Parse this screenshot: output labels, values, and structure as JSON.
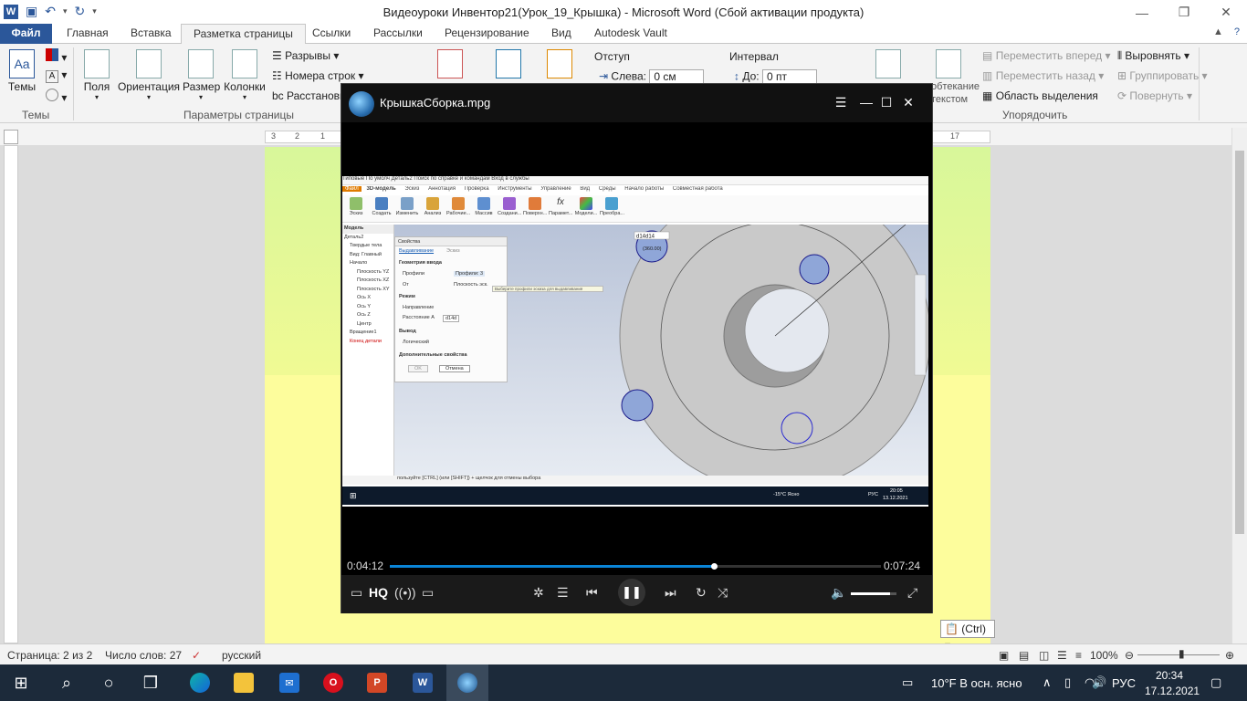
{
  "word": {
    "title": "Видеоуроки Инвентор21(Урок_19_Крышка)  -  Microsoft Word (Сбой активации продукта)",
    "tabs": {
      "file": "Файл",
      "home": "Главная",
      "insert": "Вставка",
      "page_layout": "Разметка страницы",
      "references": "Ссылки",
      "mailings": "Рассылки",
      "review": "Рецензирование",
      "view": "Вид",
      "vault": "Autodesk Vault"
    },
    "ribbon": {
      "themes": "Темы",
      "themes_group": "Темы",
      "margins": "Поля",
      "orientation": "Ориентация",
      "size": "Размер",
      "columns": "Колонки",
      "breaks": "Разрывы",
      "line_numbers": "Номера строк",
      "hyphenation": "Расстановк",
      "page_setup_group": "Параметры страницы",
      "indent_label": "Отступ",
      "indent_left_label": "Слева:",
      "indent_left_value": "0 см",
      "spacing_label": "Интервал",
      "spacing_before_label": "До:",
      "spacing_before_value": "0 пт",
      "bring_forward": "Переместить вперед",
      "send_backward": "Переместить назад",
      "selection_pane": "Область выделения",
      "align": "Выровнять",
      "group": "Группировать",
      "rotate": "Повернуть",
      "arrange_group": "Упорядочить",
      "wrap_text_1": "обтекание",
      "wrap_text_2": "текстом"
    },
    "ruler_numbers": [
      "3",
      "2",
      "1",
      "17"
    ],
    "paste_options": "(Ctrl)",
    "status": {
      "page": "Страница: 2 из 2",
      "words": "Число слов: 27",
      "language": "русский",
      "zoom": "100%"
    }
  },
  "player": {
    "title": "КрышкаСборка.mpg",
    "current_time": "0:04:12",
    "total_time": "0:07:24",
    "progress": 0.66,
    "volume": 0.85,
    "hq_label": "HQ"
  },
  "inventor": {
    "top_bar": "Типовые   По умолч   Деталь2   Поиск по справке и командам   Вход в службы",
    "tabs": [
      "Файл",
      "3D-модель",
      "Эскиз",
      "Аннотация",
      "Проверка",
      "Инструменты",
      "Управление",
      "Вид",
      "Среды",
      "Начало работы",
      "Совместная работа"
    ],
    "tools": [
      "Эскиз",
      "Создать",
      "Изменить",
      "Анализ",
      "Рабочие...",
      "Массив",
      "Создани...",
      "Поверхн...",
      "Парамет...",
      "Модели...",
      "Преобра..."
    ],
    "browser": [
      "Модель",
      "Деталь2",
      "Твердые тела",
      "Вид: Главный",
      "Начало",
      "Плоскость YZ",
      "Плоскость XZ",
      "Плоскость XY",
      "Ось X",
      "Ось Y",
      "Ось Z",
      "Центр",
      "Вращение1",
      "Конец детали"
    ],
    "props": {
      "title": "Свойства",
      "tab1": "Выдавливание",
      "tab2": "Эскиз",
      "section_geometry": "Геометрия ввода",
      "profiles_label": "Профили",
      "profiles_value": "Профили: 3",
      "from_label": "От",
      "from_value": "Плоскость эск.",
      "tooltip": "Выберите профили эскиза для выдавливания",
      "section_mode": "Режим",
      "direction_label": "Направление",
      "distance_label": "Расстояние A",
      "distance_value": "d14d",
      "section_output": "Вывод",
      "boolean_label": "Логический",
      "section_advanced": "Дополнительные свойства",
      "ok": "OK",
      "cancel": "Отмена"
    },
    "dim_label": "d14d14",
    "dim_value": "(360.00)",
    "status_text": "пользуйте [CTRL] (или [SHIFT]) + щелчок для отмены выбора",
    "taskbar_weather": "-15°C  Ясно",
    "taskbar_lang": "РУС",
    "taskbar_time": "20:05",
    "taskbar_date": "13.12.2021"
  },
  "taskbar": {
    "weather": "10°F  В осн. ясно",
    "language": "РУС",
    "time": "20:34",
    "date": "17.12.2021"
  }
}
